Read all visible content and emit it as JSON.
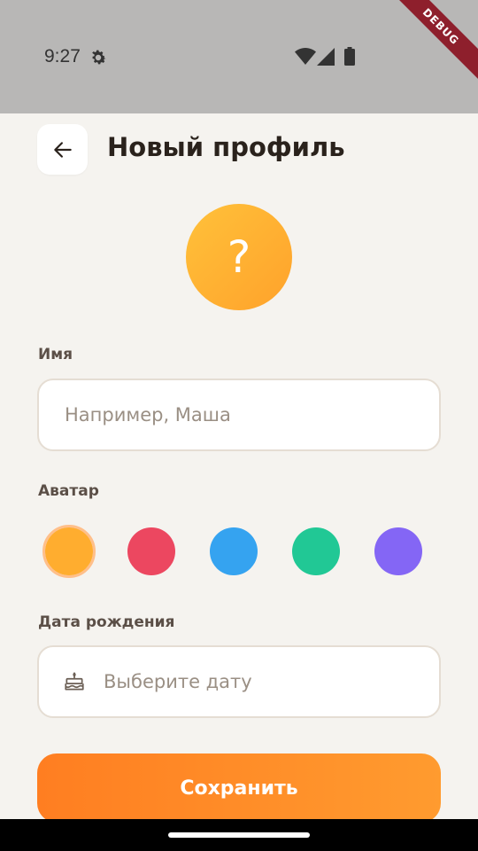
{
  "status_bar": {
    "time": "9:27",
    "debug_label": "DEBUG"
  },
  "header": {
    "title": "Новый профиль",
    "back_icon": "arrow-left-icon"
  },
  "avatar_preview": {
    "symbol": "?",
    "gradient_from": "#ffc13a",
    "gradient_to": "#ffa22b"
  },
  "form": {
    "name": {
      "label": "Имя",
      "placeholder": "Например, Маша",
      "value": ""
    },
    "avatar": {
      "label": "Аватар",
      "colors": [
        {
          "name": "orange",
          "color": "#ffad2f",
          "selected": true
        },
        {
          "name": "red",
          "color": "#ec4760",
          "selected": false
        },
        {
          "name": "blue",
          "color": "#35a3f0",
          "selected": false
        },
        {
          "name": "green",
          "color": "#21c895",
          "selected": false
        },
        {
          "name": "purple",
          "color": "#8466f5",
          "selected": false
        }
      ]
    },
    "birthdate": {
      "label": "Дата рождения",
      "placeholder": "Выберите дату",
      "icon": "cake-icon"
    }
  },
  "save_button": {
    "label": "Сохранить",
    "gradient_from": "#ff7e21",
    "gradient_to": "#ff9b2f"
  }
}
